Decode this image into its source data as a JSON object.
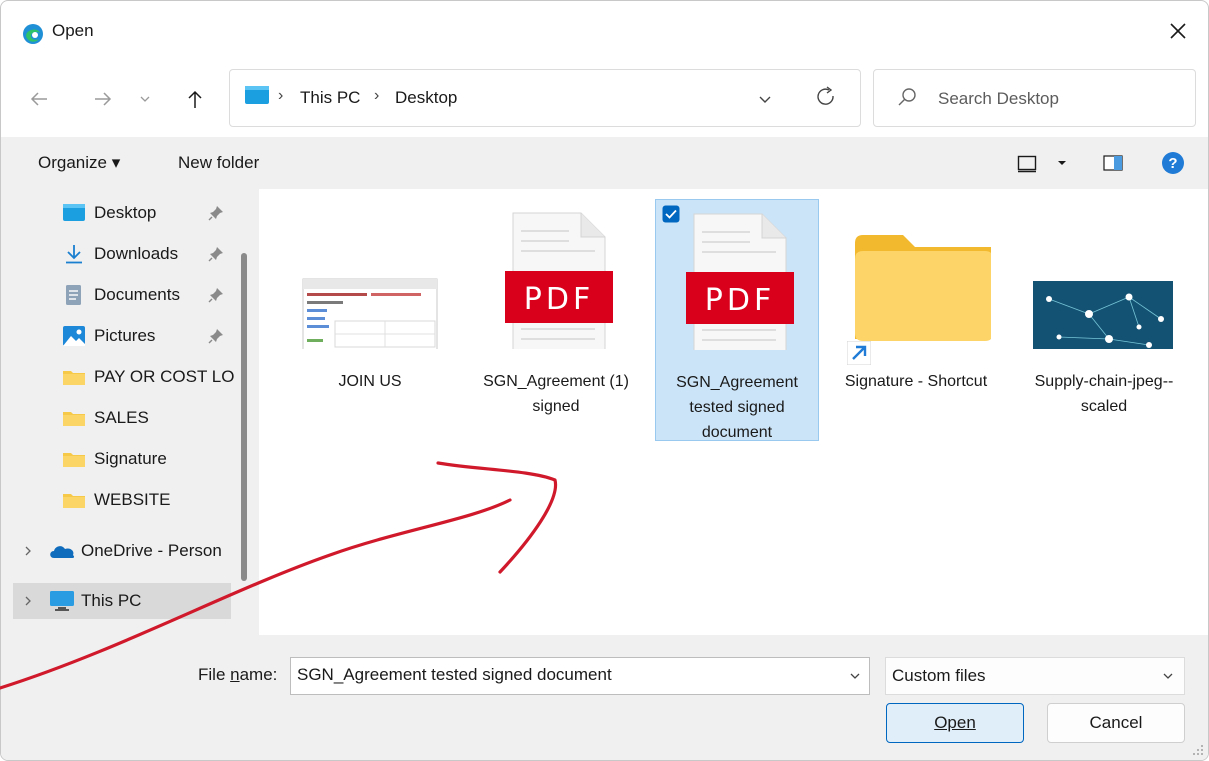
{
  "window": {
    "title": "Open",
    "close_label": "×"
  },
  "nav": {
    "back": "←",
    "forward": "→",
    "recent": "⌄",
    "up": "↑"
  },
  "address": {
    "crumbs": [
      "This PC",
      "Desktop"
    ],
    "separator": "›"
  },
  "search": {
    "placeholder": "Search Desktop"
  },
  "toolbar": {
    "organize": "Organize ▾",
    "new_folder": "New folder"
  },
  "sidebar": {
    "items": [
      {
        "label": "Desktop",
        "pinned": true
      },
      {
        "label": "Downloads",
        "pinned": true
      },
      {
        "label": "Documents",
        "pinned": true
      },
      {
        "label": "Pictures",
        "pinned": true
      },
      {
        "label": "PAY OR COST LO"
      },
      {
        "label": "SALES"
      },
      {
        "label": "Signature"
      },
      {
        "label": "WEBSITE"
      },
      {
        "label": "OneDrive - Person"
      },
      {
        "label": "This PC",
        "selected": true
      }
    ]
  },
  "files": [
    {
      "name": "JOIN US",
      "type": "image-spreadsheet"
    },
    {
      "name": "SGN_Agreement (1) signed",
      "type": "pdf",
      "badge": "PDF"
    },
    {
      "name": "SGN_Agreement tested signed document",
      "type": "pdf",
      "badge": "PDF",
      "selected": true
    },
    {
      "name": "Signature - Shortcut",
      "type": "folder-shortcut"
    },
    {
      "name": "Supply-chain-jpeg--scaled",
      "type": "image-network"
    }
  ],
  "bottom": {
    "file_name_label": "File name:",
    "file_name_value": "SGN_Agreement tested signed document",
    "file_type": "Custom files",
    "open_label": "Open",
    "cancel_label": "Cancel"
  },
  "colors": {
    "accent": "#0067c0",
    "selection": "#cce4f7",
    "pdf_red": "#d9001b",
    "ink": "#d0192b"
  }
}
